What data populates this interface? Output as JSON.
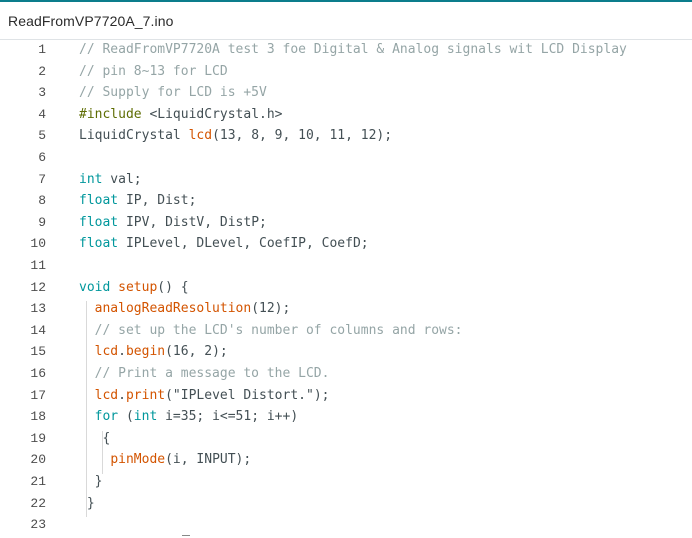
{
  "tab": {
    "label": "ReadFromVP7720A_7.ino"
  },
  "colors": {
    "accent": "#0c7d8c",
    "comment": "#95a5a6",
    "keyword": "#00979c",
    "function": "#d35400",
    "preprocessor": "#5e6d03",
    "text": "#434f54"
  },
  "lines": [
    {
      "n": "1",
      "tokens": [
        {
          "t": "// ReadFromVP7720A test 3 foe Digital & Analog signals wit LCD Display",
          "c": "comment"
        }
      ]
    },
    {
      "n": "2",
      "tokens": [
        {
          "t": "// pin 8~13 for LCD",
          "c": "comment"
        }
      ]
    },
    {
      "n": "3",
      "tokens": [
        {
          "t": "// Supply for LCD is +5V",
          "c": "comment"
        }
      ]
    },
    {
      "n": "4",
      "tokens": [
        {
          "t": "#include",
          "c": "pre"
        },
        {
          "t": " <LiquidCrystal.h>",
          "c": "plain"
        }
      ]
    },
    {
      "n": "5",
      "tokens": [
        {
          "t": "LiquidCrystal ",
          "c": "plain"
        },
        {
          "t": "lcd",
          "c": "fn"
        },
        {
          "t": "(13, 8, 9, 10, 11, 12);",
          "c": "plain"
        }
      ]
    },
    {
      "n": "6",
      "tokens": []
    },
    {
      "n": "7",
      "tokens": [
        {
          "t": "int",
          "c": "kw"
        },
        {
          "t": " val;",
          "c": "plain"
        }
      ]
    },
    {
      "n": "8",
      "tokens": [
        {
          "t": "float",
          "c": "kw"
        },
        {
          "t": " IP, Dist;",
          "c": "plain"
        }
      ]
    },
    {
      "n": "9",
      "tokens": [
        {
          "t": "float",
          "c": "kw"
        },
        {
          "t": " IPV, DistV, DistP;",
          "c": "plain"
        }
      ]
    },
    {
      "n": "10",
      "tokens": [
        {
          "t": "float",
          "c": "kw"
        },
        {
          "t": " IPLevel, DLevel, CoefIP, CoefD;",
          "c": "plain"
        }
      ]
    },
    {
      "n": "11",
      "tokens": []
    },
    {
      "n": "12",
      "tokens": [
        {
          "t": "void",
          "c": "kw"
        },
        {
          "t": " ",
          "c": "plain"
        },
        {
          "t": "setup",
          "c": "fn"
        },
        {
          "t": "() {",
          "c": "plain"
        }
      ]
    },
    {
      "n": "13",
      "tokens": [
        {
          "t": "  ",
          "c": "plain"
        },
        {
          "t": "analogReadResolution",
          "c": "fn"
        },
        {
          "t": "(12);",
          "c": "plain"
        }
      ]
    },
    {
      "n": "14",
      "tokens": [
        {
          "t": "  // set up the LCD's number of columns and rows:",
          "c": "comment"
        }
      ]
    },
    {
      "n": "15",
      "tokens": [
        {
          "t": "  ",
          "c": "plain"
        },
        {
          "t": "lcd",
          "c": "fn"
        },
        {
          "t": ".",
          "c": "plain"
        },
        {
          "t": "begin",
          "c": "fn"
        },
        {
          "t": "(16, 2);",
          "c": "plain"
        }
      ]
    },
    {
      "n": "16",
      "tokens": [
        {
          "t": "  // Print a message to the LCD.",
          "c": "comment"
        }
      ]
    },
    {
      "n": "17",
      "tokens": [
        {
          "t": "  ",
          "c": "plain"
        },
        {
          "t": "lcd",
          "c": "fn"
        },
        {
          "t": ".",
          "c": "plain"
        },
        {
          "t": "print",
          "c": "fn"
        },
        {
          "t": "(\"IPLevel Distort.\");",
          "c": "plain"
        }
      ]
    },
    {
      "n": "18",
      "tokens": [
        {
          "t": "  ",
          "c": "plain"
        },
        {
          "t": "for",
          "c": "kw"
        },
        {
          "t": " (",
          "c": "plain"
        },
        {
          "t": "int",
          "c": "kw"
        },
        {
          "t": " i=35; i<=51; i++)",
          "c": "plain"
        }
      ]
    },
    {
      "n": "19",
      "tokens": [
        {
          "t": "   {",
          "c": "plain"
        }
      ]
    },
    {
      "n": "20",
      "tokens": [
        {
          "t": "    ",
          "c": "plain"
        },
        {
          "t": "pinMode",
          "c": "fn"
        },
        {
          "t": "(i, INPUT);",
          "c": "plain"
        }
      ]
    },
    {
      "n": "21",
      "tokens": [
        {
          "t": "  }",
          "c": "plain"
        }
      ]
    },
    {
      "n": "22",
      "tokens": [
        {
          "t": " }",
          "c": "plain"
        }
      ]
    },
    {
      "n": "23",
      "tokens": []
    }
  ]
}
